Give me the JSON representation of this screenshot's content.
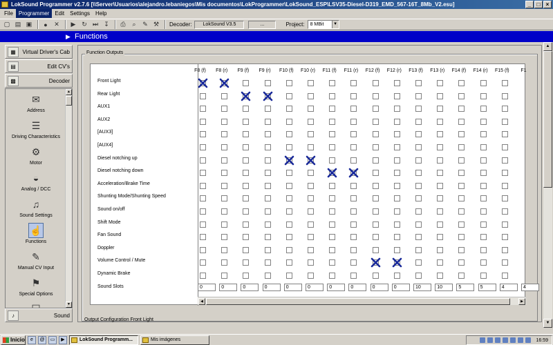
{
  "window": {
    "title": "LokSound Programmer  v2.7.6  [\\\\Server\\Usuarios\\alejandro.lebaniegos\\Mis documentos\\LokProgrammer\\LokSound_ESP\\LSV35-Diesel-D319_EMD_567-16T_8Mb_V2.esu]"
  },
  "menu": [
    "File",
    "Programmer",
    "Edit",
    "Settings",
    "Help"
  ],
  "toolbar": {
    "decoder_label": "Decoder:",
    "decoder_value": "LokSound V3.5",
    "decoder_extra": "...",
    "project_label": "Project:",
    "project_value": "8 MBit"
  },
  "header": {
    "title": "Functions"
  },
  "sidebar": {
    "tabs": [
      {
        "label": "Virtual Driver's Cab"
      },
      {
        "label": "Edit CV's"
      },
      {
        "label": "Decoder"
      }
    ],
    "items": [
      {
        "label": "Address"
      },
      {
        "label": "Driving Characteristics"
      },
      {
        "label": "Motor"
      },
      {
        "label": "Analog / DCC"
      },
      {
        "label": "Sound Settings"
      },
      {
        "label": "Functions"
      },
      {
        "label": "Manual CV Input"
      },
      {
        "label": "Special Options"
      }
    ],
    "bottom_tab": {
      "label": "Sound"
    }
  },
  "function_outputs": {
    "legend": "Function Outputs",
    "columns": [
      "F8 (f)",
      "F8 (r)",
      "F9 (f)",
      "F9 (r)",
      "F10 (f)",
      "F10 (r)",
      "F11 (f)",
      "F11 (r)",
      "F12 (f)",
      "F12 (r)",
      "F13 (f)",
      "F13 (r)",
      "F14 (f)",
      "F14 (r)",
      "F15 (f)",
      "F1"
    ],
    "rows": [
      {
        "label": "Front Light",
        "checked": [
          0,
          1
        ]
      },
      {
        "label": "Rear Light",
        "checked": [
          2,
          3
        ]
      },
      {
        "label": "AUX1",
        "checked": []
      },
      {
        "label": "AUX2",
        "checked": []
      },
      {
        "label": "[AUX3]",
        "checked": []
      },
      {
        "label": "[AUX4]",
        "checked": []
      },
      {
        "label": "Diesel notching up",
        "checked": [
          4,
          5
        ]
      },
      {
        "label": "Diesel notching down",
        "checked": [
          6,
          7
        ]
      },
      {
        "label": "Acceleration/Brake Time",
        "checked": []
      },
      {
        "label": "Shunting Mode/Shunting Speed",
        "checked": []
      },
      {
        "label": "Sound on/off",
        "checked": []
      },
      {
        "label": "Shift Mode",
        "checked": []
      },
      {
        "label": "Fan Sound",
        "checked": []
      },
      {
        "label": "Doppler",
        "checked": []
      },
      {
        "label": "Volume Control / Mute",
        "checked": [
          8,
          9
        ]
      },
      {
        "label": "Dynamic Brake",
        "checked": []
      }
    ],
    "sound_slots_label": "Sound Slots",
    "sound_slots": [
      "0",
      "0",
      "0",
      "0",
      "0",
      "0",
      "0",
      "0",
      "0",
      "0",
      "10",
      "10",
      "5",
      "5",
      "4",
      "4"
    ]
  },
  "second_group": {
    "legend": "Output Configuration Front Light"
  },
  "taskbar": {
    "start": "Inicio",
    "tasks": [
      "LokSound Programm...",
      "Mis imágenes"
    ],
    "clock": "16:59"
  }
}
